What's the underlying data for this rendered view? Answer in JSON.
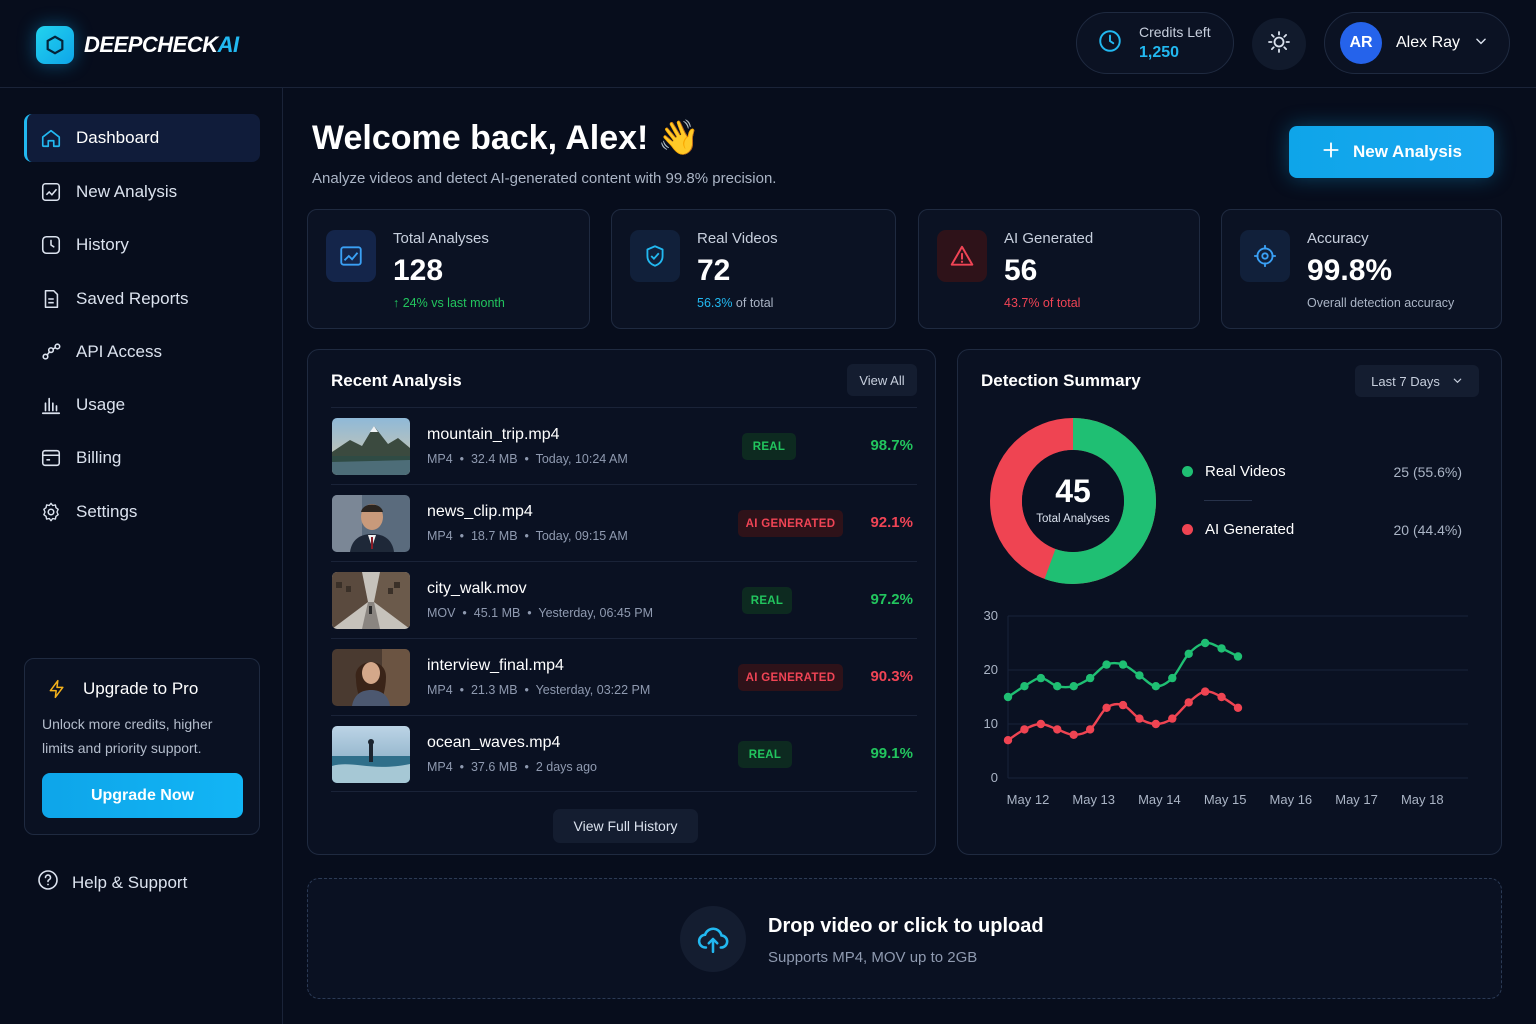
{
  "app": {
    "brand": "DEEPCHECK",
    "brand_suffix": "AI"
  },
  "header": {
    "credits_label": "Credits Left",
    "credits_value": "1,250",
    "user_initials": "AR",
    "user_name": "Alex Ray"
  },
  "sidebar": {
    "items": [
      {
        "label": "Dashboard",
        "icon": "home-icon",
        "active": true
      },
      {
        "label": "New Analysis",
        "icon": "new-analysis-icon"
      },
      {
        "label": "History",
        "icon": "history-icon"
      },
      {
        "label": "Saved Reports",
        "icon": "saved-reports-icon"
      },
      {
        "label": "API Access",
        "icon": "api-icon"
      },
      {
        "label": "Usage",
        "icon": "usage-icon"
      },
      {
        "label": "Billing",
        "icon": "billing-icon"
      },
      {
        "label": "Settings",
        "icon": "gear-icon"
      }
    ],
    "upgrade": {
      "title": "Upgrade to Pro",
      "text": "Unlock more credits, higher limits and priority support.",
      "button": "Upgrade Now"
    },
    "help": "Help & Support"
  },
  "main": {
    "welcome": "Welcome back, Alex! 👋",
    "subtitle": "Analyze videos and detect AI-generated content with 99.8% precision.",
    "new_analysis_button": "New Analysis"
  },
  "stats": [
    {
      "label": "Total Analyses",
      "value": "128",
      "sub": "↑ 24% vs last month",
      "sub_color": "#22c55e"
    },
    {
      "label": "Real Videos",
      "value": "72",
      "sub_accent": "56.3%",
      "sub_rest": " of total",
      "accent_color": "#22b8f0"
    },
    {
      "label": "AI Generated",
      "value": "56",
      "sub": "43.7% of total",
      "sub_color": "#f04455"
    },
    {
      "label": "Accuracy",
      "value": "99.8%",
      "sub": "Overall detection accuracy",
      "sub_color": "#aab4c5"
    }
  ],
  "recent": {
    "title": "Recent Analysis",
    "view_all": "View All",
    "rows": [
      {
        "name": "mountain_trip.mp4",
        "type": "MP4",
        "size": "32.4 MB",
        "time": "Today, 10:24 AM",
        "badge": "REAL",
        "score": "98.7%"
      },
      {
        "name": "news_clip.mp4",
        "type": "MP4",
        "size": "18.7 MB",
        "time": "Today, 09:15 AM",
        "badge": "AI GENERATED",
        "score": "92.1%"
      },
      {
        "name": "city_walk.mov",
        "type": "MOV",
        "size": "45.1 MB",
        "time": "Yesterday, 06:45 PM",
        "badge": "REAL",
        "score": "97.2%"
      },
      {
        "name": "interview_final.mp4",
        "type": "MP4",
        "size": "21.3 MB",
        "time": "Yesterday, 03:22 PM",
        "badge": "AI GENERATED",
        "score": "90.3%"
      },
      {
        "name": "ocean_waves.mp4",
        "type": "MP4",
        "size": "37.6 MB",
        "time": "2 days ago",
        "badge": "REAL",
        "score": "99.1%"
      }
    ],
    "view_history": "View Full History"
  },
  "summary": {
    "title": "Detection Summary",
    "range": "Last 7 Days",
    "total": "45",
    "total_label": "Total Analyses",
    "legend": [
      {
        "name": "Real Videos",
        "value": "25 (55.6%)",
        "color": "#1fbf73"
      },
      {
        "name": "AI Generated",
        "value": "20 (44.4%)",
        "color": "#ef4452"
      }
    ]
  },
  "chart_data": {
    "type": "line",
    "x_ticks": [
      "May 12",
      "May 13",
      "May 14",
      "May 15",
      "May 16",
      "May 17",
      "May 18"
    ],
    "x": [
      0,
      0.5,
      1,
      1.5,
      2,
      2.5,
      3,
      3.5,
      4,
      4.5,
      5,
      5.5,
      6,
      6.5,
      7,
      7.5,
      8,
      8.5,
      9,
      9.5,
      10,
      10.5,
      11,
      11.5,
      12,
      12.5,
      13,
      13.5,
      14
    ],
    "ylim": [
      0,
      30
    ],
    "y_ticks": [
      0,
      10,
      20,
      30
    ],
    "grid": true,
    "series": [
      {
        "values": [
          15,
          17,
          18.5,
          17,
          17,
          18.5,
          21,
          21,
          19,
          17,
          18.5,
          23,
          25,
          24,
          22.5
        ],
        "color": "#1fbf73"
      },
      {
        "values": [
          7,
          9,
          10,
          9,
          8,
          9,
          13,
          13.5,
          11,
          10,
          11,
          14,
          16,
          15,
          13
        ],
        "color": "#ef4452"
      }
    ]
  },
  "upload": {
    "title": "Drop video or click to upload",
    "subtitle": "Supports MP4, MOV up to 2GB"
  }
}
